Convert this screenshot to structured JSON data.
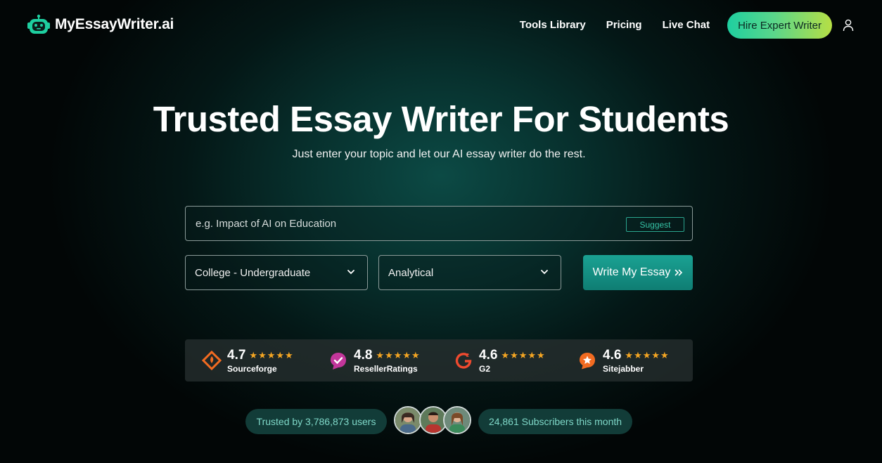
{
  "brand": {
    "name": "MyEssayWriter.ai",
    "accent": "#1ecfa0"
  },
  "nav": {
    "links": [
      "Tools Library",
      "Pricing",
      "Live Chat"
    ],
    "cta": "Hire Expert Writer",
    "user_icon": "user-icon"
  },
  "hero": {
    "title": "Trusted Essay Writer For Students",
    "subtitle": "Just enter your topic and let our AI essay writer do the rest."
  },
  "form": {
    "topic_placeholder": "e.g. Impact of AI on Education",
    "topic_value": "",
    "suggest_label": "Suggest",
    "level_selected": "College - Undergraduate",
    "type_selected": "Analytical",
    "submit_label": "Write My Essay",
    "submit_icon": "double-chevron-right-icon"
  },
  "ratings": [
    {
      "score": "4.7",
      "stars": "★★★★★",
      "name": "Sourceforge",
      "icon": "sourceforge-icon",
      "rating": 4.7
    },
    {
      "score": "4.8",
      "stars": "★★★★★",
      "name": "ResellerRatings",
      "icon": "resellerratings-icon",
      "rating": 4.8
    },
    {
      "score": "4.6",
      "stars": "★★★★★",
      "name": "G2",
      "icon": "g2-icon",
      "rating": 4.6
    },
    {
      "score": "4.6",
      "stars": "★★★★★",
      "name": "Sitejabber",
      "icon": "sitejabber-icon",
      "rating": 4.6
    }
  ],
  "social_proof": {
    "trusted": "Trusted by 3,786,873 users",
    "subscribers": "24,861 Subscribers this month"
  }
}
